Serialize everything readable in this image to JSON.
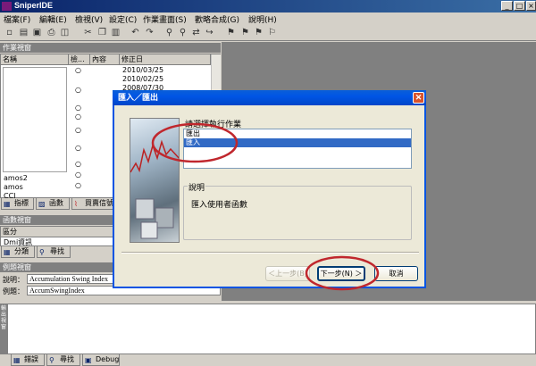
{
  "window": {
    "title": "SniperIDE",
    "min": "_",
    "max": "□",
    "close": "×"
  },
  "menu": [
    "檔案(F)",
    "編輯(E)",
    "檢視(V)",
    "設定(C)",
    "作業畫面(S)",
    "歡略合成(G)",
    "說明(H)"
  ],
  "toolbar_icons": [
    "new-icon",
    "open-icon",
    "save-icon",
    "print-icon",
    "preview-icon",
    "cut-icon",
    "copy-icon",
    "paste-icon",
    "undo-icon",
    "redo-icon",
    "find-icon",
    "find-next-icon",
    "replace-icon",
    "goto-icon",
    "bookmark-icon",
    "bookmark-prev-icon",
    "bookmark-next-icon",
    "bookmark-clear-icon"
  ],
  "work_pane": {
    "title": "作業視窗",
    "columns": [
      "名稱",
      "檢...",
      "內容",
      "修正日"
    ],
    "dates": [
      "2010/03/25",
      "2010/02/25",
      "2008/07/30"
    ],
    "names": [
      "amos2",
      "amos",
      "CCI"
    ],
    "tabs": [
      "指標",
      "函數",
      "買賣信號"
    ]
  },
  "func_pane": {
    "title": "函數視窗",
    "column": "區分",
    "row": "Dmi資訊",
    "tabs": [
      "分類",
      "尋找"
    ]
  },
  "example_pane": {
    "title": "例題視窗",
    "desc_label": "說明：",
    "desc_value": "Accumulation Swing Index",
    "example_label": "例題：",
    "example_value": "AccumSwingIndex"
  },
  "dialog": {
    "title": "匯入／匯出",
    "prompt": "請選擇執行作業",
    "options": [
      "匯出",
      "匯入"
    ],
    "selected_index": 1,
    "desc_group": "說明",
    "desc_text": "匯入使用者函數",
    "back_button": "＜上一步(B)",
    "next_button": "下一步(N) ＞",
    "cancel_button": "取消"
  },
  "output_pane": {
    "side_label": "輸出視窗",
    "tabs": [
      "錯誤",
      "尋找",
      "Debug"
    ]
  },
  "colors": {
    "title_xp": "#0055e5",
    "highlight": "#316ac5",
    "annotation": "#c0272d"
  }
}
